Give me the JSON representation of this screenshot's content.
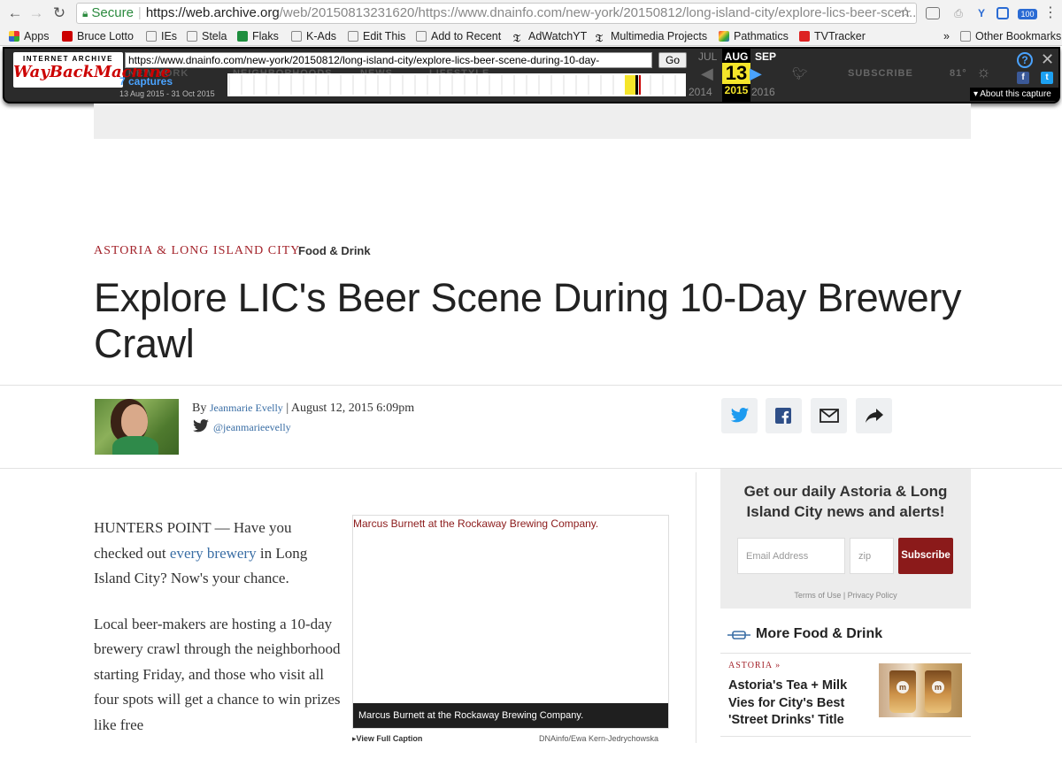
{
  "browser": {
    "secure_label": "Secure",
    "url_host": "https://web.archive.org",
    "url_path": "/web/20150813231620/https://www.dnainfo.com/new-york/20150812/long-island-city/explore-lics-beer-scen...",
    "bookmarks": [
      "Apps",
      "Bruce Lotto",
      "IEs",
      "Stela",
      "Flaks",
      "K-Ads",
      "Edit This",
      "Add to Recent",
      "AdWatchYT",
      "Multimedia Projects",
      "Pathmatics",
      "TVTracker"
    ],
    "other_bookmarks": "Other Bookmarks",
    "ext_badge": "100"
  },
  "wayback": {
    "logo_top": "INTERNET ARCHIVE",
    "logo_main": "WayBackMachine",
    "url_value": "https://www.dnainfo.com/new-york/20150812/long-island-city/explore-lics-beer-scene-during-10-day-",
    "go_label": "Go",
    "captures": "7 captures",
    "range": "13 Aug 2015 - 31 Oct 2015",
    "prev_month": "JUL",
    "cur_month": "AUG",
    "next_month": "SEP",
    "cur_day": "13",
    "prev_year": "2014",
    "cur_year": "2015",
    "next_year": "2016",
    "about": "About this capture",
    "behind_nav": [
      "NEW YORK",
      "NEIGHBORHOODS",
      "NEWS",
      "LIFESTYLE"
    ],
    "behind_right": [
      "SUBSCRIBE",
      "81°"
    ]
  },
  "article": {
    "category": "ASTORIA & LONG ISLAND CITY",
    "subcategory": "Food & Drink",
    "headline": "Explore LIC's Beer Scene During 10-Day Brewery Crawl",
    "by_prefix": "By",
    "author": "Jeanmarie Evelly",
    "byline_sep": "|",
    "date": "August 12, 2015 6:09pm",
    "twitter_handle": "@jeanmarieevelly",
    "p1_a": "HUNTERS POINT — Have you checked out ",
    "p1_link": "every brewery",
    "p1_b": " in Long Island City? Now's your chance.",
    "p2": "Local beer-makers are hosting a 10-day brewery crawl through the neighborhood starting Friday, and those who visit all four spots will get a chance to win prizes like free",
    "photo_alt": "Marcus Burnett at the Rockaway Brewing Company.",
    "photo_caption": "Marcus Burnett at the Rockaway Brewing Company.",
    "view_caption": "▸View Full Caption",
    "photo_credit": "DNAinfo/Ewa Kern-Jedrychowska"
  },
  "sidebar": {
    "newsletter_title": "Get our daily Astoria & Long Island City news and alerts!",
    "email_placeholder": "Email Address",
    "zip_placeholder": "zip",
    "subscribe_label": "Subscribe",
    "terms": "Terms of Use",
    "privacy": "Privacy Policy",
    "more_title": "More Food & Drink",
    "story_cat": "ASTORIA »",
    "story_title": "Astoria's Tea + Milk Vies for City's Best 'Street Drinks' Title"
  },
  "colors": {
    "accent_red": "#a3222a",
    "link_blue": "#3a6ea5",
    "subscribe_bg": "#8b1a1a"
  }
}
